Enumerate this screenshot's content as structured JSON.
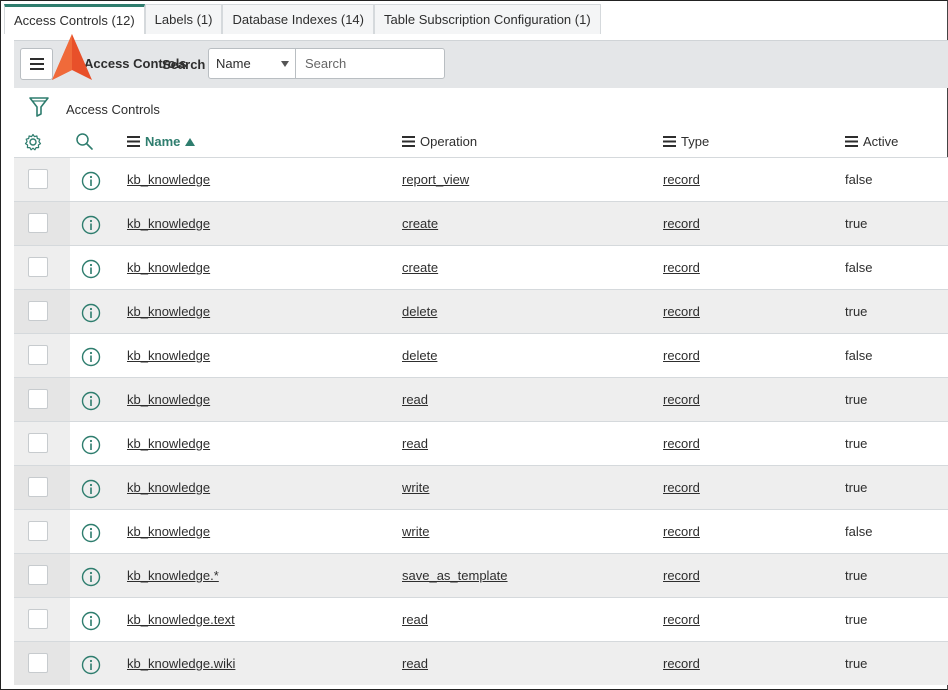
{
  "tabs": [
    {
      "label": "Access Controls (12)",
      "active": true
    },
    {
      "label": "Labels (1)",
      "active": false
    },
    {
      "label": "Database Indexes (14)",
      "active": false
    },
    {
      "label": "Table Subscription Configuration (1)",
      "active": false
    }
  ],
  "header": {
    "title": "Access Controls",
    "search_label": "Search",
    "select_value": "Name",
    "search_placeholder": "Search"
  },
  "breadcrumb": {
    "text": "Access Controls"
  },
  "columns": {
    "name": "Name",
    "operation": "Operation",
    "type": "Type",
    "active": "Active"
  },
  "rows": [
    {
      "name": "kb_knowledge",
      "operation": "report_view",
      "type": "record",
      "active": "false"
    },
    {
      "name": "kb_knowledge",
      "operation": "create",
      "type": "record",
      "active": "true"
    },
    {
      "name": "kb_knowledge",
      "operation": "create",
      "type": "record",
      "active": "false"
    },
    {
      "name": "kb_knowledge",
      "operation": "delete",
      "type": "record",
      "active": "true"
    },
    {
      "name": "kb_knowledge",
      "operation": "delete",
      "type": "record",
      "active": "false"
    },
    {
      "name": "kb_knowledge",
      "operation": "read",
      "type": "record",
      "active": "true"
    },
    {
      "name": "kb_knowledge",
      "operation": "read",
      "type": "record",
      "active": "true"
    },
    {
      "name": "kb_knowledge",
      "operation": "write",
      "type": "record",
      "active": "true"
    },
    {
      "name": "kb_knowledge",
      "operation": "write",
      "type": "record",
      "active": "false"
    },
    {
      "name": "kb_knowledge.*",
      "operation": "save_as_template",
      "type": "record",
      "active": "true"
    },
    {
      "name": "kb_knowledge.text",
      "operation": "read",
      "type": "record",
      "active": "true"
    },
    {
      "name": "kb_knowledge.wiki",
      "operation": "read",
      "type": "record",
      "active": "true"
    }
  ],
  "colors": {
    "accent": "#2e7d6e",
    "pointer": "#e8502a",
    "header_bg": "#e4e6e8",
    "row_alt": "#eeeeee"
  },
  "icons": {
    "menu": "hamburger-icon",
    "filter": "filter-icon",
    "settings": "gear-icon",
    "search": "search-icon",
    "info": "info-icon",
    "column_menu": "column-menu-icon",
    "sort": "sort-ascending-icon",
    "pointer": "arrow-pointer-icon"
  }
}
